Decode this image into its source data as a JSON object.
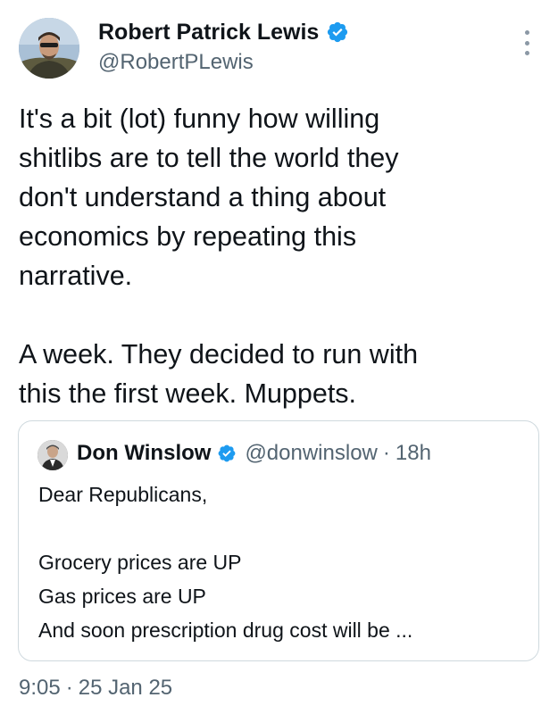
{
  "author": {
    "name": "Robert Patrick Lewis",
    "handle": "@RobertPLewis",
    "verified_icon": "verified-badge-icon",
    "accent_color": "#1d9bf0"
  },
  "tweet": {
    "text": "It's a bit (lot) funny how willing\nshitlibs are to tell the world they\ndon't understand a thing about\neconomics by repeating this\nnarrative.\n\nA week. They decided to run with\nthis the first week. Muppets."
  },
  "quoted": {
    "name": "Don Winslow",
    "handle": "@donwinslow",
    "separator": "·",
    "time": "18h",
    "text": "Dear Republicans,\n\nGrocery prices are UP\nGas prices are UP\nAnd soon prescription drug cost will be ..."
  },
  "meta": {
    "time": "9:05",
    "separator": "·",
    "date": "25 Jan 25"
  },
  "menu": {
    "icon": "more-vertical-icon"
  }
}
